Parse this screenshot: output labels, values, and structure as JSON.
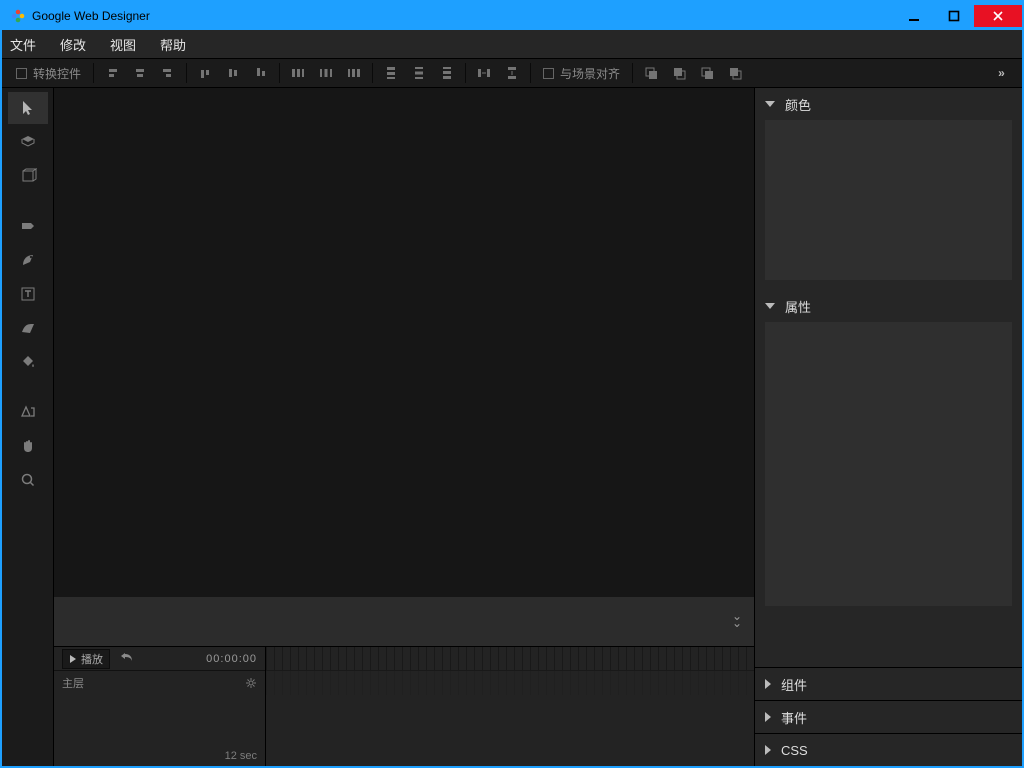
{
  "window": {
    "title": "Google Web Designer"
  },
  "menu": {
    "file": "文件",
    "edit": "修改",
    "view": "视图",
    "help": "帮助"
  },
  "optbar": {
    "convert_ctrl": "转换控件",
    "align_stage": "与场景对齐"
  },
  "timeline": {
    "play_label": "播放",
    "time": "00:00:00",
    "layer_label": "主层",
    "duration_label": "12 sec"
  },
  "panels": {
    "color": "颜色",
    "properties": "属性",
    "components": "组件",
    "events": "事件",
    "css": "CSS"
  }
}
